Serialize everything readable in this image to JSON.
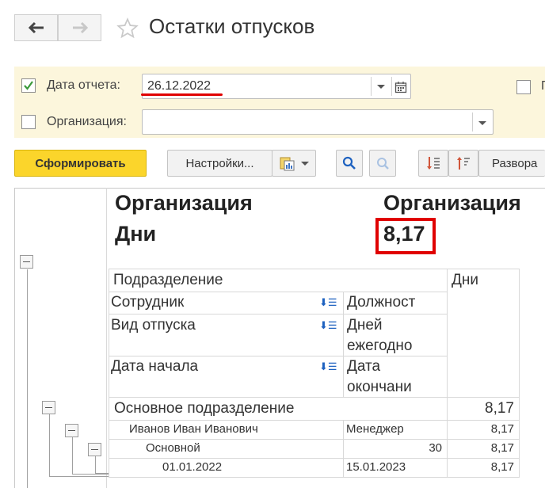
{
  "window": {
    "title": "Остатки отпусков"
  },
  "icons": {
    "back": "arrow-left-icon",
    "forward": "arrow-right-icon",
    "favorite": "star-icon"
  },
  "params": {
    "report_date": {
      "label": "Дата отчета:",
      "value": "26.12.2022",
      "checked": true
    },
    "organization": {
      "label": "Организация:",
      "value": "",
      "checked": false
    },
    "extra_checkbox_partial": "П"
  },
  "toolbar": {
    "generate": "Сформировать",
    "settings": "Настройки...",
    "expand_partial": "Разворa"
  },
  "report": {
    "header_left_line1": "Организация",
    "header_left_line2": "Дни",
    "header_right_line1": "Организация",
    "header_right_value": "8,17",
    "columns": {
      "department": "Подразделение",
      "days": "Дни",
      "employee": "Сотрудник",
      "position": "Должност",
      "vacation_type": "Вид отпуска",
      "annual_days_1": "Дней",
      "annual_days_2": "ежегодно",
      "start_date": "Дата начала",
      "end_date_1": "Дата",
      "end_date_2": "окончани"
    },
    "rows": {
      "department_name": "Основное подразделение",
      "department_days": "8,17",
      "employee_name": "Иванов Иван Иванович",
      "employee_position": "Менеджер",
      "employee_days": "8,17",
      "type_name": "Основной",
      "type_annual": "30",
      "type_days": "8,17",
      "period_start": "01.01.2022",
      "period_end": "15.01.2023",
      "period_days": "8,17"
    }
  },
  "colors": {
    "accent": "#fbd52b",
    "highlight": "#e00000",
    "panel": "#fcf6dc",
    "check": "#3a9a3a"
  }
}
